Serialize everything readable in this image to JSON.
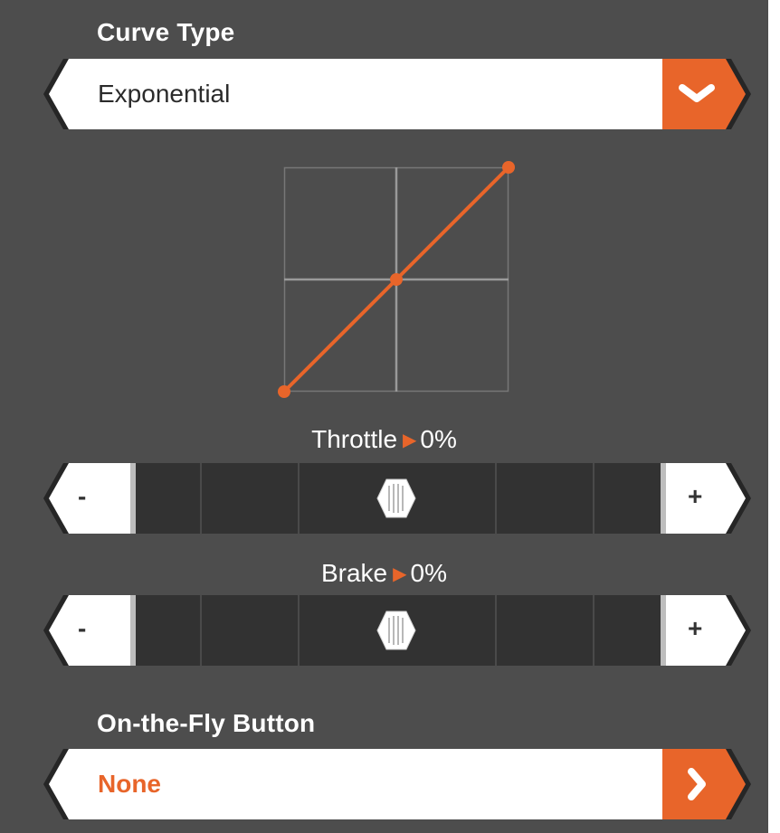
{
  "curve_type": {
    "label": "Curve Type",
    "value": "Exponential",
    "dropdown_icon": "chevron-down-icon"
  },
  "curve_graph": {
    "points": [
      [
        0,
        0
      ],
      [
        0.5,
        0.5
      ],
      [
        1,
        1
      ]
    ],
    "line_color": "#e8652a"
  },
  "throttle": {
    "label": "Throttle",
    "value": "0%",
    "level": 0,
    "minus_label": "-",
    "plus_label": "+"
  },
  "brake": {
    "label": "Brake",
    "value": "0%",
    "level": 0,
    "minus_label": "-",
    "plus_label": "+"
  },
  "on_the_fly": {
    "label": "On-the-Fly Button",
    "value": "None",
    "button_icon": "chevron-right-icon"
  },
  "colors": {
    "accent": "#e8652a",
    "panel": "#4d4d4d",
    "track": "#323232"
  }
}
